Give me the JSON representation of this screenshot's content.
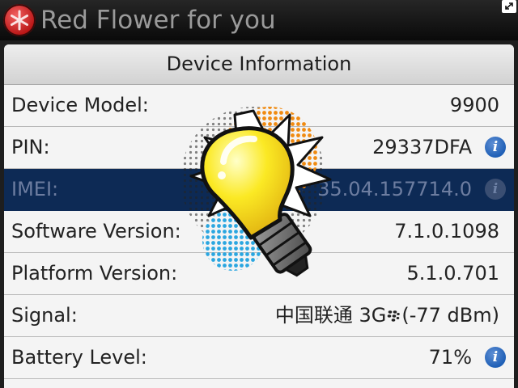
{
  "window": {
    "title": "Red Flower for you",
    "app_icon": "red-flower-icon",
    "expand_icon": "expand-icon"
  },
  "panel": {
    "header": "Device Information",
    "rows": [
      {
        "label": "Device Model:",
        "value": "9900",
        "info": false
      },
      {
        "label": "PIN:",
        "value": "29337DFA",
        "info": true
      },
      {
        "label": "IMEI:",
        "value": "35.04.157714.0",
        "info": true,
        "selected": true
      },
      {
        "label": "Software Version:",
        "value": "7.1.0.1098",
        "info": false
      },
      {
        "label": "Platform Version:",
        "value": "5.1.0.701",
        "info": false
      },
      {
        "label": "Signal:",
        "value_prefix": "中国联通 3G",
        "value_suffix": "(-77 dBm)",
        "signal_icon": "blackberry-logo-icon",
        "info": false
      },
      {
        "label": "Battery Level:",
        "value": "71%",
        "info": true
      }
    ]
  },
  "overlay": {
    "icon": "lightbulb-icon"
  },
  "colors": {
    "selection": "#0d2a55",
    "info_icon": "#1f5fb6",
    "app_icon": "#b81414",
    "bulb_yellow": "#f5e11a",
    "bulb_orange": "#f08a10"
  }
}
